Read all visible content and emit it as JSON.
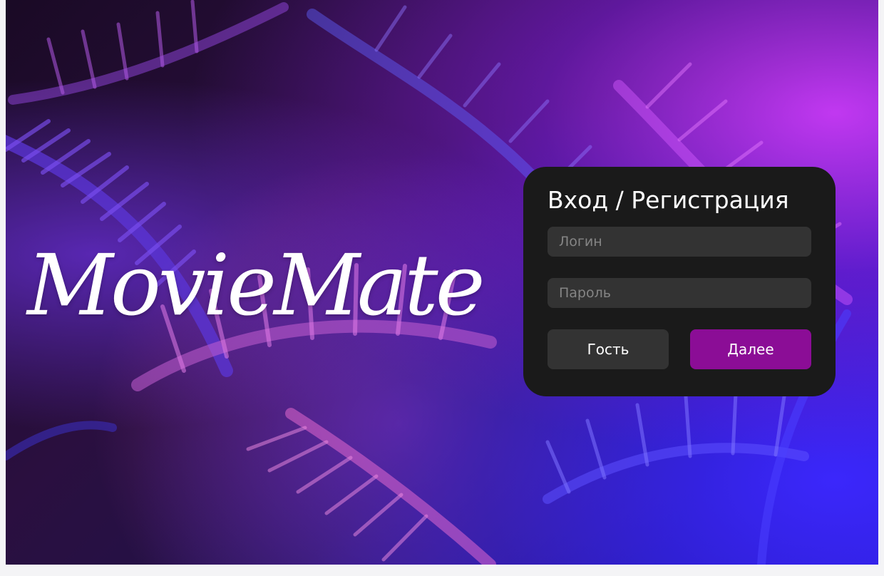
{
  "brand": {
    "logo_text": "MovieMate"
  },
  "auth": {
    "title": "Вход / Регистрация",
    "login_placeholder": "Логин",
    "password_placeholder": "Пароль",
    "guest_label": "Гость",
    "next_label": "Далее"
  },
  "colors": {
    "card_background": "#1a1a1a",
    "field_background": "#333333",
    "guest_button": "#333333",
    "next_button": "#8b0d96",
    "text": "#ffffff",
    "placeholder": "#858585"
  }
}
